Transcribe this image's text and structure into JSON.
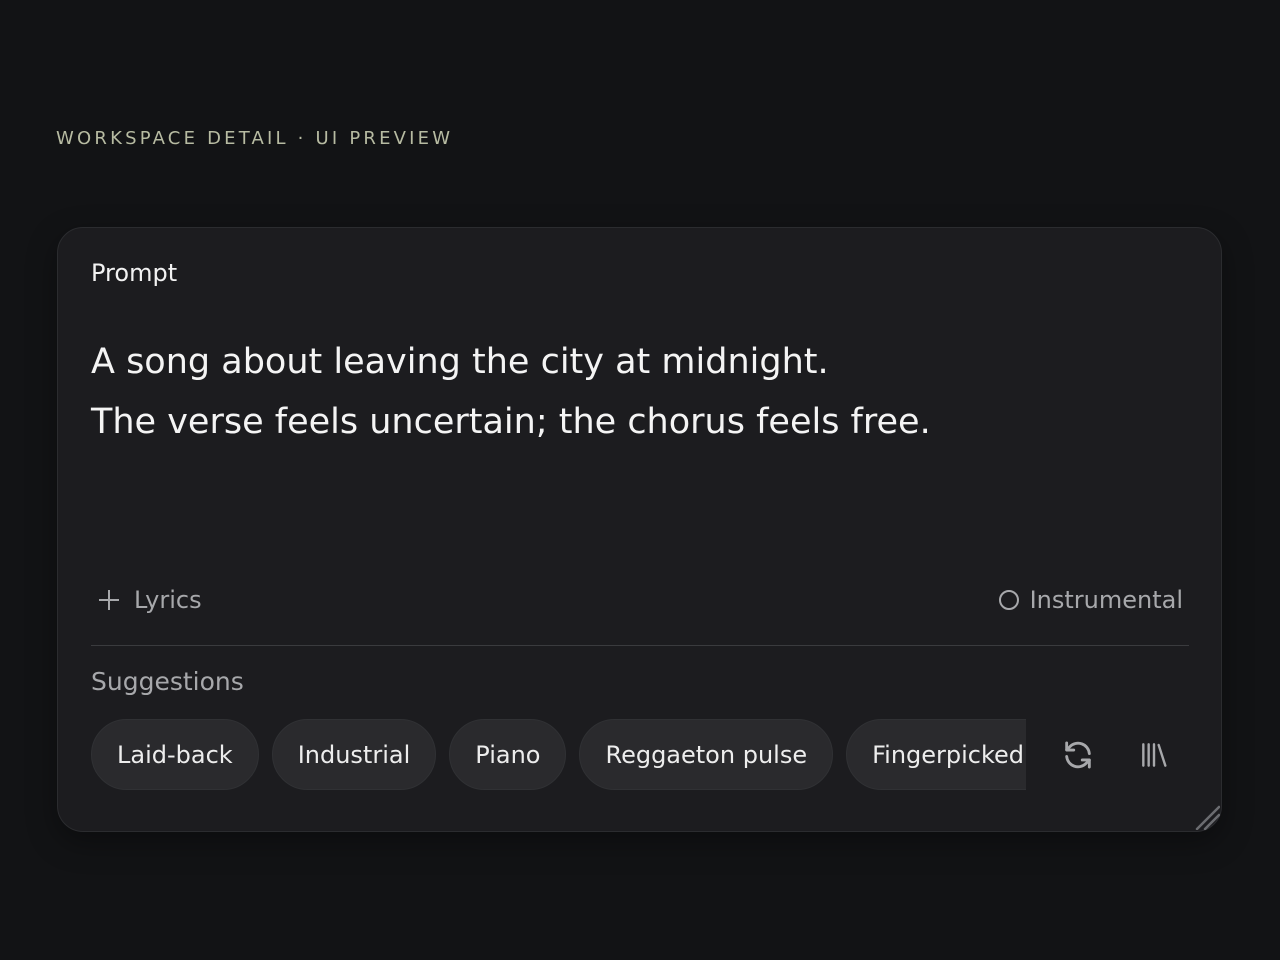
{
  "header": {
    "eyebrow": "WORKSPACE DETAIL · UI PREVIEW"
  },
  "prompt_card": {
    "title": "Prompt",
    "text_lines": [
      "A song about leaving the city at midnight.",
      "The verse feels uncertain; the chorus feels free."
    ],
    "lyrics_label": "Lyrics",
    "instrumental_label": "Instrumental",
    "instrumental_checked": false
  },
  "suggestions": {
    "label": "Suggestions",
    "chips": [
      "Laid-back",
      "Industrial",
      "Piano",
      "Reggaeton pulse",
      "Fingerpicked guitar"
    ]
  },
  "icons": {
    "lyrics": "plus-icon",
    "instrumental": "radio-icon",
    "refresh": "refresh-icon",
    "library": "library-icon",
    "resize": "resize-grip-icon"
  }
}
